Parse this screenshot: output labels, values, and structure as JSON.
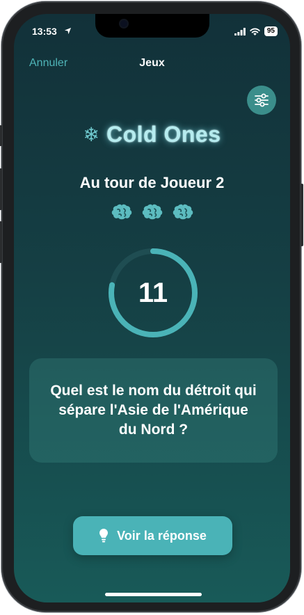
{
  "status_bar": {
    "time": "13:53",
    "battery": "95"
  },
  "nav": {
    "cancel_label": "Annuler",
    "title": "Jeux"
  },
  "game": {
    "name": "Cold Ones",
    "turn_text": "Au tour de Joueur 2",
    "lives_count": 3,
    "timer_value": "11",
    "timer_progress": 0.78,
    "question": "Quel est le nom du détroit qui sépare l'Asie de l'Amérique du Nord ?"
  },
  "actions": {
    "reveal_label": "Voir la réponse"
  },
  "colors": {
    "accent": "#4ab3b7",
    "accent_light": "#b6ecef",
    "background_top": "#123139",
    "background_bottom": "#185a58",
    "settings_button": "#3b8e8b"
  },
  "icons": {
    "location": "location-arrow-icon",
    "signal": "cellular-signal-icon",
    "wifi": "wifi-icon",
    "settings": "sliders-icon",
    "brand": "snowflake-icon",
    "life": "brain-icon",
    "hint": "lightbulb-icon"
  }
}
